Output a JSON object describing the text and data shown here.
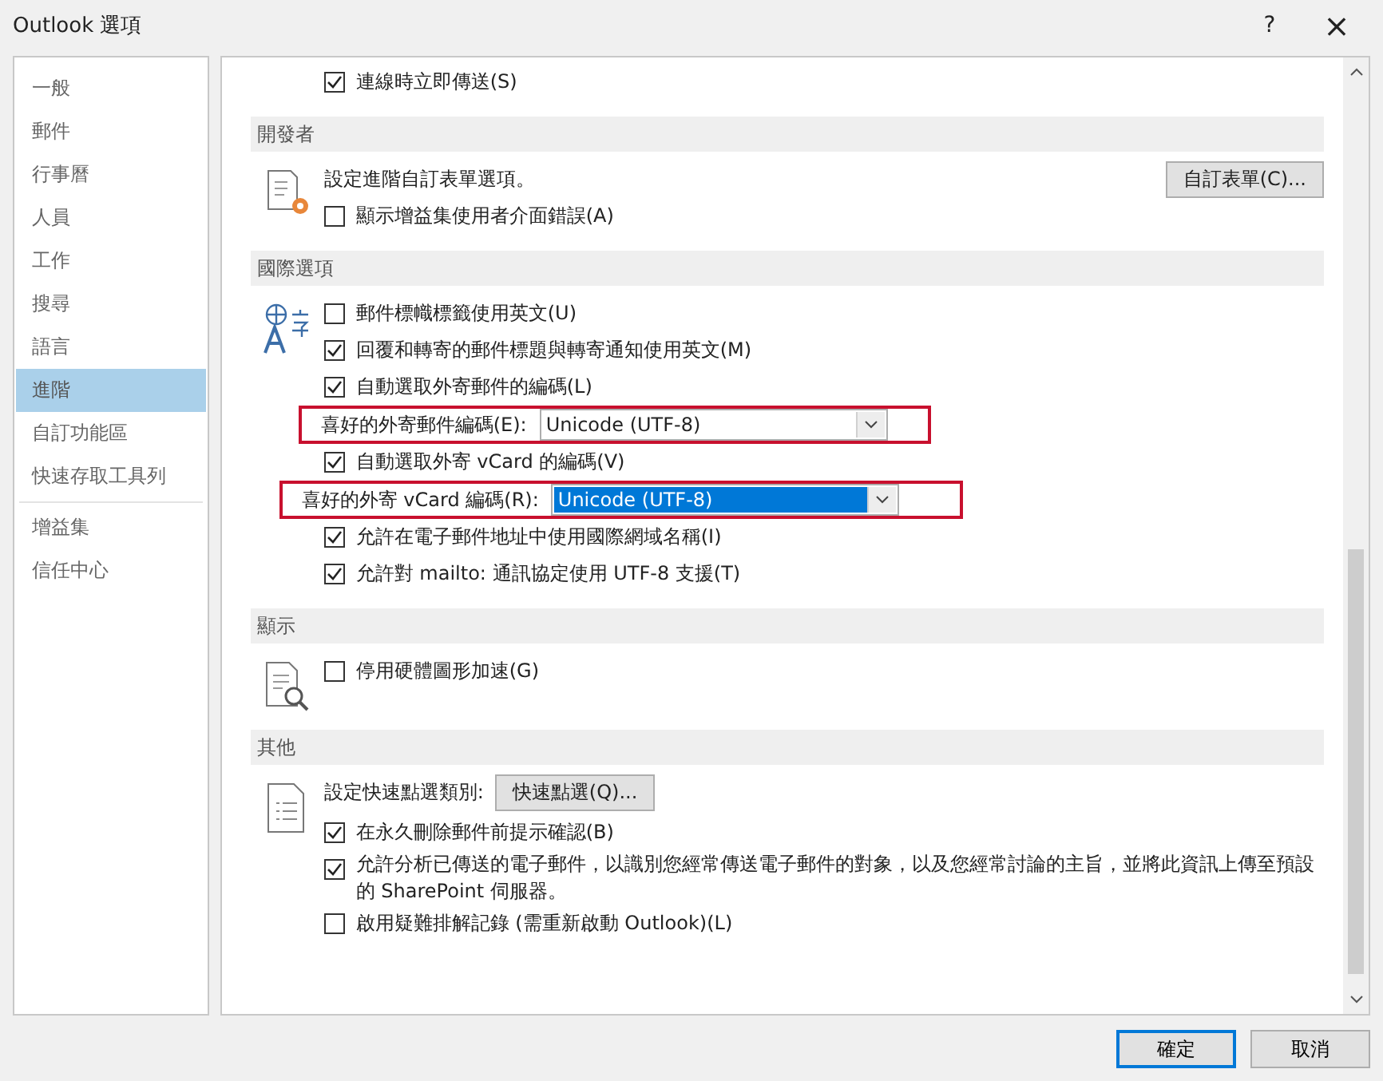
{
  "window": {
    "title": "Outlook 選項",
    "help": "?",
    "close": "×"
  },
  "sidebar": {
    "groups": [
      [
        {
          "label": "一般",
          "selected": false
        },
        {
          "label": "郵件",
          "selected": false
        },
        {
          "label": "行事曆",
          "selected": false
        },
        {
          "label": "人員",
          "selected": false
        },
        {
          "label": "工作",
          "selected": false
        },
        {
          "label": "搜尋",
          "selected": false
        },
        {
          "label": "語言",
          "selected": false
        },
        {
          "label": "進階",
          "selected": true
        },
        {
          "label": "自訂功能區",
          "selected": false
        },
        {
          "label": "快速存取工具列",
          "selected": false
        }
      ],
      [
        {
          "label": "增益集",
          "selected": false
        },
        {
          "label": "信任中心",
          "selected": false
        }
      ]
    ]
  },
  "sections": [
    {
      "rows": [
        {
          "kind": "checkbox",
          "label": "連線時立即傳送(S)",
          "checked": true
        }
      ]
    },
    {
      "header": "開發者",
      "rows": [
        {
          "kind": "text-button",
          "label": "設定進階自訂表單選項。",
          "button": "自訂表單(C)..."
        },
        {
          "kind": "checkbox",
          "label": "顯示增益集使用者介面錯誤(A)",
          "checked": false
        }
      ]
    },
    {
      "header": "國際選項",
      "rows": [
        {
          "kind": "checkbox",
          "label": "郵件標幟標籤使用英文(U)",
          "checked": false
        },
        {
          "kind": "checkbox",
          "label": "回覆和轉寄的郵件標題與轉寄通知使用英文(M)",
          "checked": true
        },
        {
          "kind": "checkbox",
          "label": "自動選取外寄郵件的編碼(L)",
          "checked": true
        },
        {
          "kind": "dropdown",
          "label": "喜好的外寄郵件編碼(E):",
          "value": "Unicode (UTF-8)",
          "highlighted": true,
          "text_selected": false
        },
        {
          "kind": "checkbox",
          "label": "自動選取外寄 vCard 的編碼(V)",
          "checked": true
        },
        {
          "kind": "dropdown",
          "label": "喜好的外寄 vCard 編碼(R):",
          "value": "Unicode (UTF-8)",
          "highlighted": true,
          "text_selected": true
        },
        {
          "kind": "checkbox",
          "label": "允許在電子郵件地址中使用國際網域名稱(I)",
          "checked": true
        },
        {
          "kind": "checkbox",
          "label": "允許對 mailto: 通訊協定使用 UTF-8 支援(T)",
          "checked": true
        }
      ]
    },
    {
      "header": "顯示",
      "rows": [
        {
          "kind": "checkbox",
          "label": "停用硬體圖形加速(G)",
          "checked": false
        }
      ]
    },
    {
      "header": "其他",
      "rows": [
        {
          "kind": "label-button",
          "label": "設定快速點選類別:",
          "button": "快速點選(Q)..."
        },
        {
          "kind": "checkbox",
          "label": "在永久刪除郵件前提示確認(B)",
          "checked": true
        },
        {
          "kind": "checkbox",
          "label": "允許分析已傳送的電子郵件，以識別您經常傳送電子郵件的對象，以及您經常討論的主旨，並將此資訊上傳至預設的 SharePoint 伺服器。",
          "checked": true
        },
        {
          "kind": "checkbox",
          "label": "啟用疑難排解記錄 (需重新啟動 Outlook)(L)",
          "checked": false
        }
      ]
    }
  ],
  "footer": {
    "buttons": [
      {
        "label": "確定",
        "default": true
      },
      {
        "label": "取消",
        "default": false
      }
    ]
  }
}
